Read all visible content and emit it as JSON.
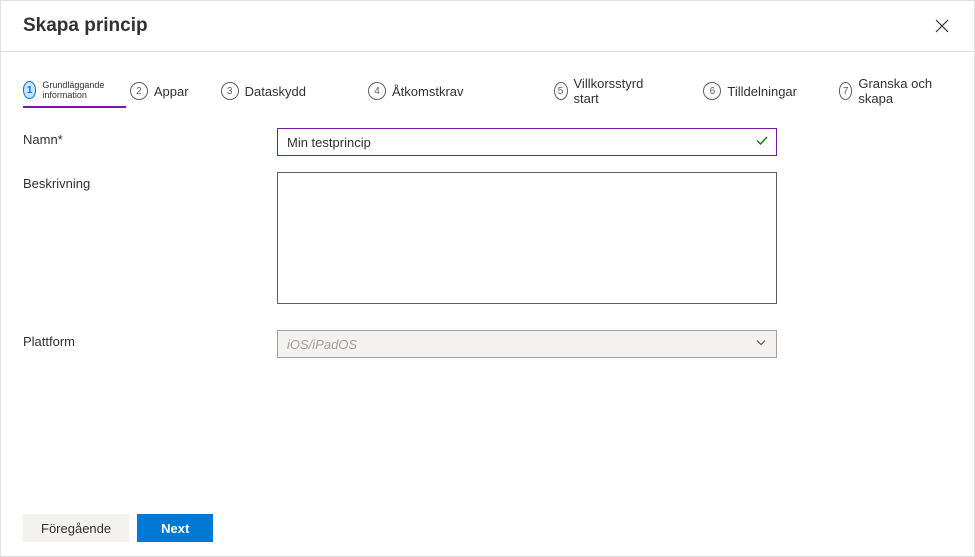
{
  "header": {
    "title": "Skapa princip"
  },
  "steps": [
    {
      "num": "1",
      "label": "Grundläggande information"
    },
    {
      "num": "2",
      "label": "Appar"
    },
    {
      "num": "3",
      "label": "Dataskydd"
    },
    {
      "num": "4",
      "label": "Åtkomstkrav"
    },
    {
      "num": "5",
      "label": "Villkorsstyrd start"
    },
    {
      "num": "6",
      "label": "Tilldelningar"
    },
    {
      "num": "7",
      "label": "Granska och skapa"
    }
  ],
  "form": {
    "name_label": "Namn*",
    "name_value": "Min testprincip",
    "description_label": "Beskrivning",
    "description_value": "",
    "platform_label": "Plattform",
    "platform_value": "iOS/iPadOS"
  },
  "footer": {
    "previous_label": "Föregående",
    "next_label": "Next"
  }
}
